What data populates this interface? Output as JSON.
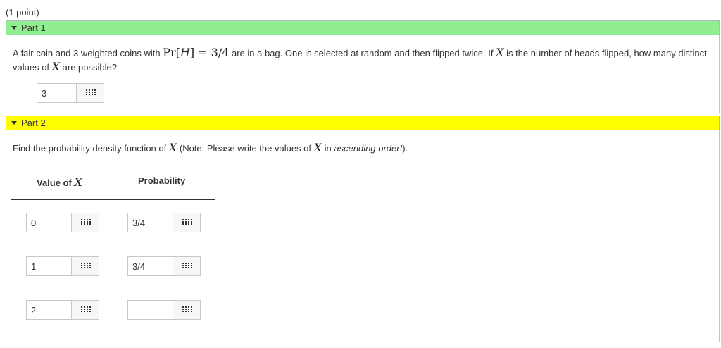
{
  "points_label": "(1 point)",
  "part1": {
    "header": "Part 1",
    "question": {
      "t1": "A fair coin and 3 weighted coins with ",
      "m_pr": "Pr",
      "m_lb": "[",
      "m_h": "H",
      "m_rb": "]",
      "m_eq": " = 3/4",
      "t2": " are in a bag. One is selected at random and then flipped twice. If ",
      "m_x": "X",
      "t3": " is the number of heads flipped, how many distinct values of ",
      "m_x2": "X",
      "t4": " are possible?"
    },
    "answer_value": "3"
  },
  "part2": {
    "header": "Part 2",
    "question": {
      "t1": "Find the probability density function of ",
      "m_x": "X",
      "t2": " (Note: Please write the values of ",
      "m_x2": "X",
      "t3": " in ",
      "t_em": "ascending order!",
      "t4": ")."
    },
    "table": {
      "col1_text": "Value of ",
      "col1_math": "X",
      "col2": "Probability",
      "rows": [
        {
          "value": "0",
          "probability": "3/4"
        },
        {
          "value": "1",
          "probability": "3/4"
        },
        {
          "value": "2",
          "probability": ""
        }
      ]
    }
  }
}
